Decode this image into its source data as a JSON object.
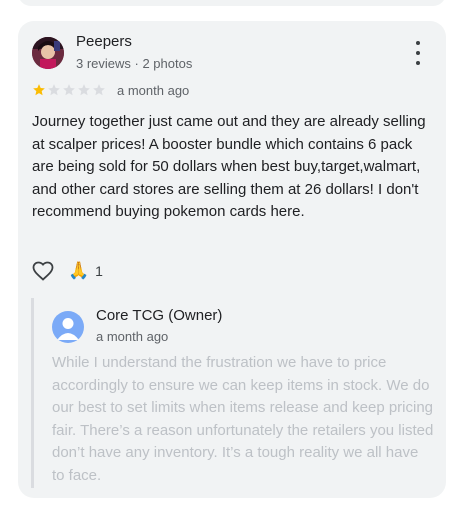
{
  "review": {
    "author": "Peepers",
    "meta": "3 reviews · 2 photos",
    "rating": 1,
    "max_rating": 5,
    "time": "a month ago",
    "text": "Journey together just came out and they are already selling at scalper prices! A booster bundle which contains 6 pack are being sold for 50 dollars when best buy,target,walmart, and other card stores are selling them at 26 dollars! I don't recommend buying pokemon cards here.",
    "reaction_emoji": "🙏",
    "reaction_count": "1"
  },
  "owner_reply": {
    "name": "Core TCG (Owner)",
    "time": "a month ago",
    "text": "While I understand the frustration we have to price accordingly to ensure we can keep items in stock. We do our best to set limits when items release and keep pricing fair. There’s a reason unfortunately the retailers you listed don’t have any inventory. It’s a tough reality we all have to face."
  },
  "colors": {
    "card_bg": "#f1f3f4",
    "star_filled": "#fbbc04",
    "star_empty": "#dadce0",
    "owner_avatar": "#7baaf7"
  },
  "icons": {
    "more": "more-vert-icon",
    "like": "heart-outline-icon",
    "reaction": "folded-hands-emoji"
  }
}
